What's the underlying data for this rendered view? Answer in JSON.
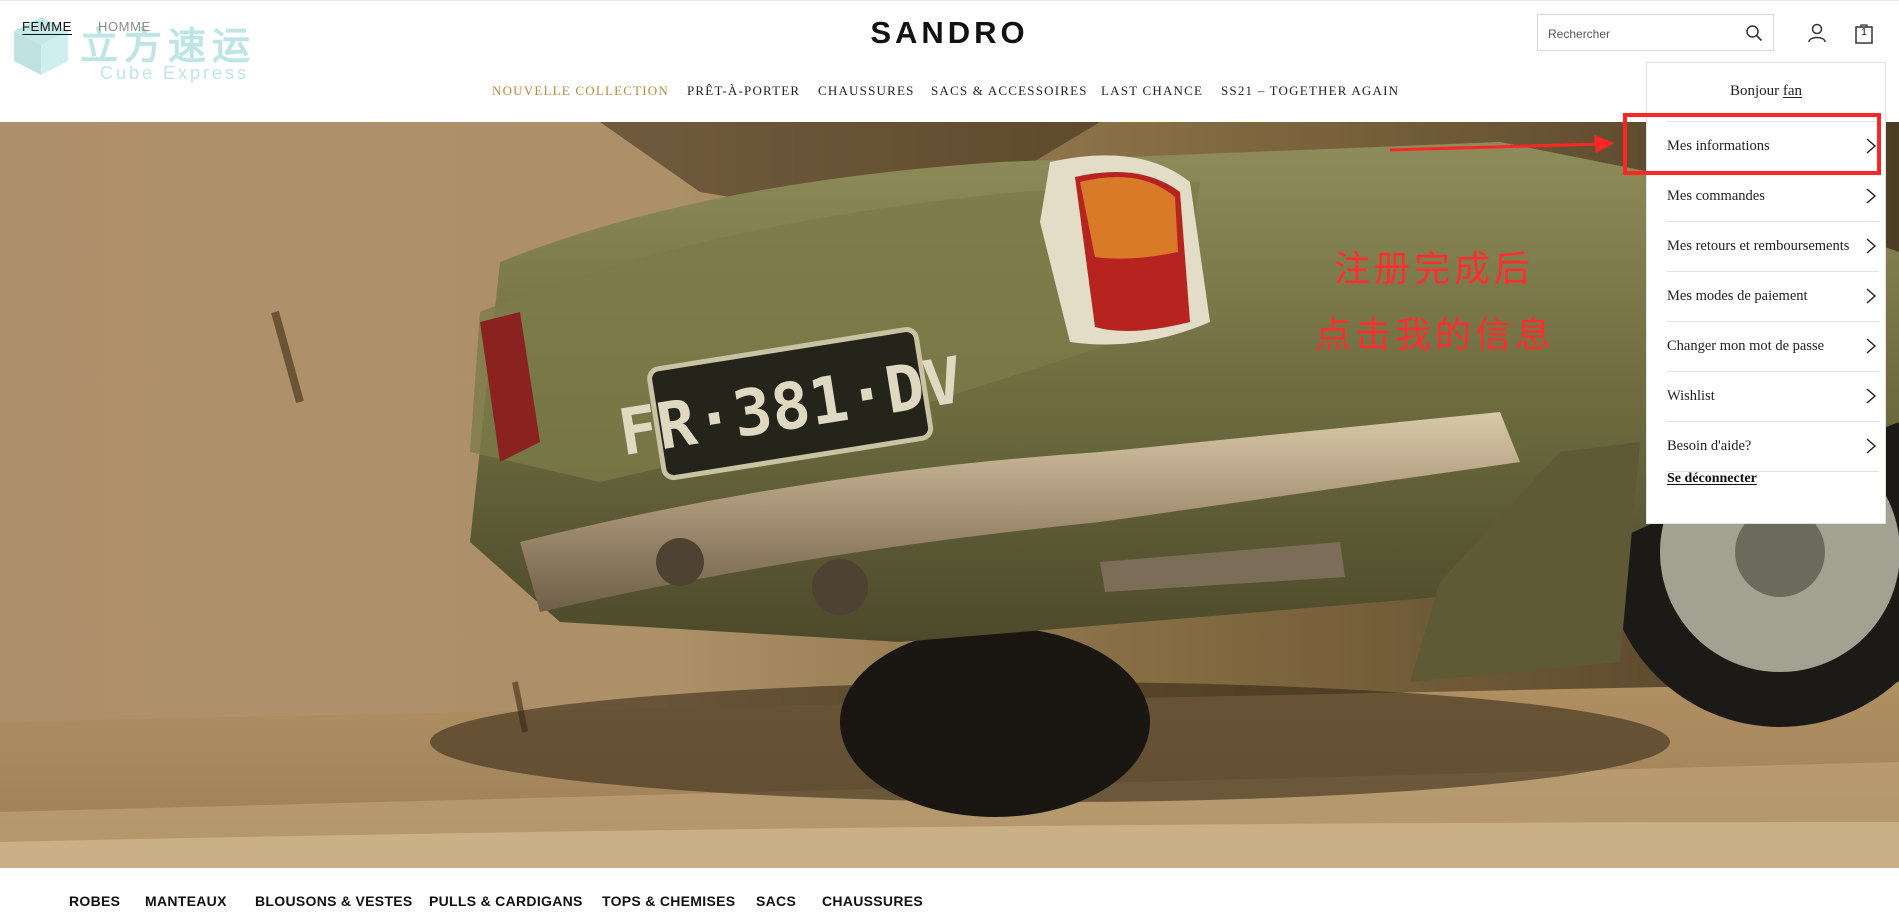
{
  "watermark": {
    "cn": "立方速运",
    "en": "Cube Express"
  },
  "gender": {
    "femme": "FEMME",
    "homme": "HOMME"
  },
  "brand": {
    "logo": "SANDRO"
  },
  "search": {
    "placeholder": "Rechercher"
  },
  "cart": {
    "count": "1"
  },
  "nav": {
    "items": [
      {
        "label": "NOUVELLE COLLECTION",
        "color": "#b88a3c"
      },
      {
        "label": "PRÊT-À-PORTER"
      },
      {
        "label": "CHAUSSURES"
      },
      {
        "label": "SACS & ACCESSOIRES"
      },
      {
        "label": "LAST CHANCE"
      },
      {
        "label": "SS21 – TOGETHER AGAIN"
      }
    ]
  },
  "hero": {
    "plate": "FR·381·DV"
  },
  "annotation": {
    "line1": "注册完成后",
    "line2": "点击我的信息",
    "color": "#ff2626"
  },
  "account_menu": {
    "greeting_prefix": "Bonjour",
    "username": "fan",
    "items": [
      {
        "label": "Mes informations",
        "highlighted": true
      },
      {
        "label": "Mes commandes"
      },
      {
        "label": "Mes retours et remboursements"
      },
      {
        "label": "Mes modes de paiement"
      },
      {
        "label": "Changer mon mot de passe"
      },
      {
        "label": "Wishlist"
      },
      {
        "label": "Besoin d'aide?"
      }
    ],
    "logout": "Se déconnecter"
  },
  "categories": [
    "ROBES",
    "MANTEAUX",
    "BLOUSONS & VESTES",
    "PULLS & CARDIGANS",
    "TOPS & CHEMISES",
    "SACS",
    "CHAUSSURES"
  ]
}
